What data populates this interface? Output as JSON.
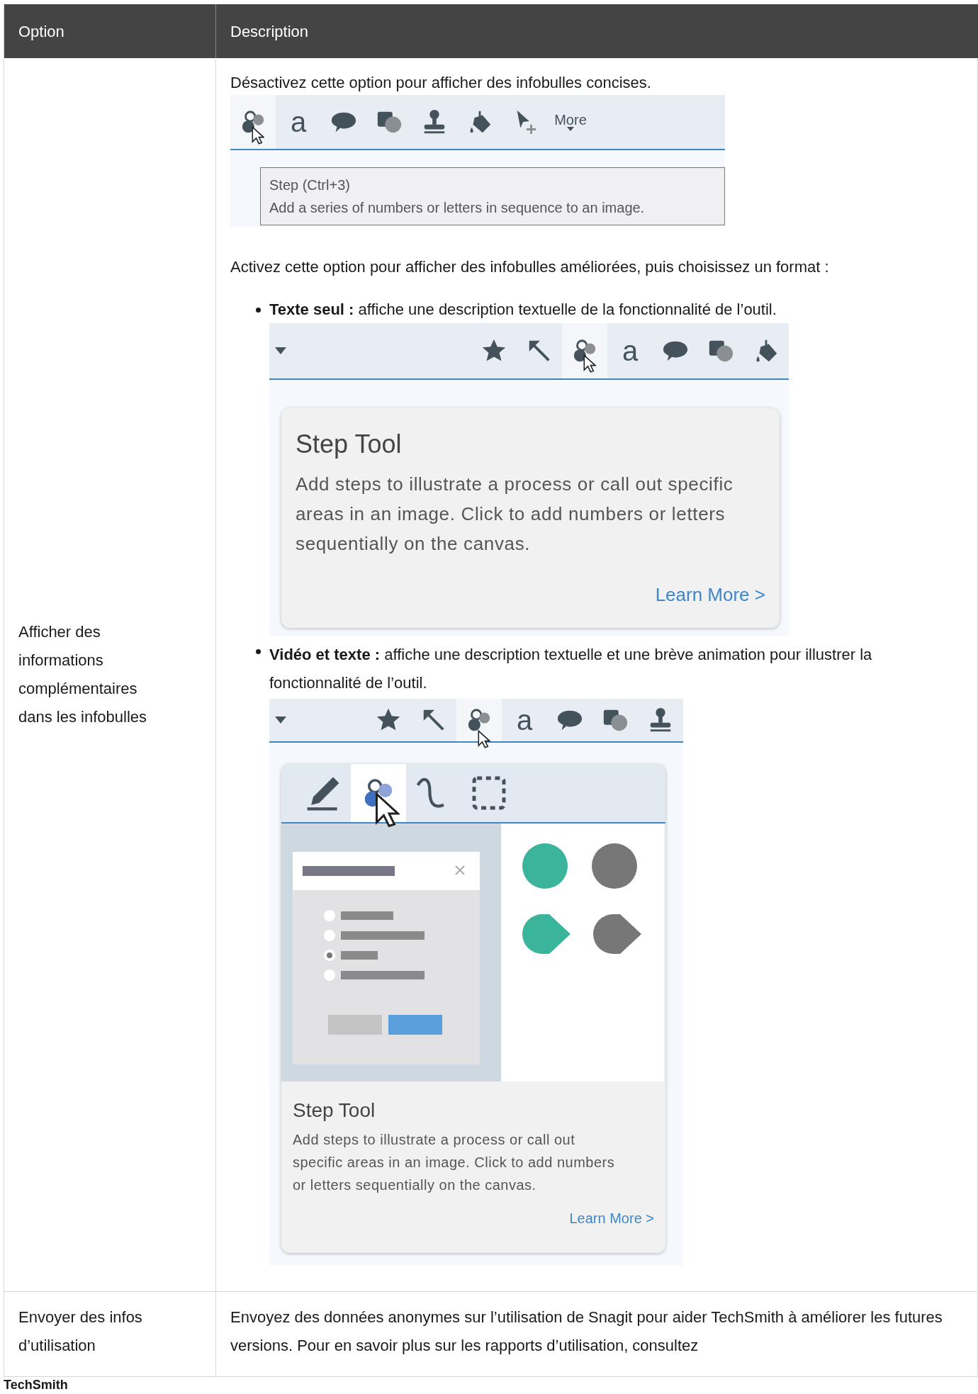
{
  "table": {
    "columns": [
      "Option",
      "Description"
    ],
    "rows": [
      {
        "option": "Afficher des informations complémentaires dans les infobulles",
        "intro": "Désactivez cette option pour afficher des infobulles concises.",
        "concise_screenshot": {
          "tools": [
            {
              "kind": "step",
              "selected": true
            },
            {
              "kind": "text",
              "label": "a",
              "selected": false
            },
            {
              "kind": "callout",
              "selected": false
            },
            {
              "kind": "shape",
              "selected": false
            },
            {
              "kind": "stamp",
              "selected": false
            },
            {
              "kind": "fill",
              "selected": false
            },
            {
              "kind": "move",
              "selected": false
            },
            {
              "kind": "more",
              "label": "More",
              "selected": false
            }
          ],
          "tooltip_title": "Step (Ctrl+3)",
          "tooltip_text": "Add a series of numbers or letters in sequence to an image."
        },
        "enhanced_intro": "Activez cette option pour afficher des infobulles améliorées, puis choisissez un format :",
        "formats": [
          {
            "kind": "text",
            "text": "**Texte seul :** affiche une description textuelle de la fonctionnalité de l’outil.",
            "tools": [
              {
                "kind": "star",
                "selected": false
              },
              {
                "kind": "arrow",
                "selected": false
              },
              {
                "kind": "step",
                "selected": true
              },
              {
                "kind": "text",
                "label": "a",
                "selected": false
              },
              {
                "kind": "callout",
                "selected": false
              },
              {
                "kind": "shape",
                "selected": false
              },
              {
                "kind": "fill",
                "selected": false
              }
            ],
            "card_title": "Step Tool",
            "card_text": "Add steps to illustrate a process or call out specific areas in an image. Click to add numbers or letters sequentially on the canvas.",
            "card_link": "Learn More >"
          },
          {
            "kind": "video",
            "text": "**Vidéo et texte :** affiche une description textuelle et une brève animation pour illustrer la fonctionnalité de l’outil.",
            "tools": [
              {
                "kind": "star",
                "selected": false
              },
              {
                "kind": "arrow",
                "selected": false
              },
              {
                "kind": "step",
                "selected": true
              },
              {
                "kind": "text",
                "label": "a",
                "selected": false
              },
              {
                "kind": "callout",
                "selected": false
              },
              {
                "kind": "shape",
                "selected": false
              },
              {
                "kind": "stamp",
                "selected": false
              }
            ],
            "video_tools": [
              {
                "kind": "pen",
                "selected": false
              },
              {
                "kind": "step",
                "selected": true
              },
              {
                "kind": "curve",
                "selected": false
              },
              {
                "kind": "selection",
                "selected": false
              }
            ],
            "card_title": "Step Tool",
            "card_text": "Add steps to illustrate a process or call out specific areas in an image. Click to add numbers or letters sequentially on the canvas.",
            "card_link": "Learn More >"
          }
        ]
      },
      {
        "option": "Envoyer des infos d’utilisation",
        "description": "Envoyez des données anonymes sur l’utilisation de Snagit pour aider TechSmith à améliorer les futures versions. Pour en savoir plus sur les rapports d’utilisation, consultez"
      }
    ]
  },
  "footer_brand": "TechSmith"
}
